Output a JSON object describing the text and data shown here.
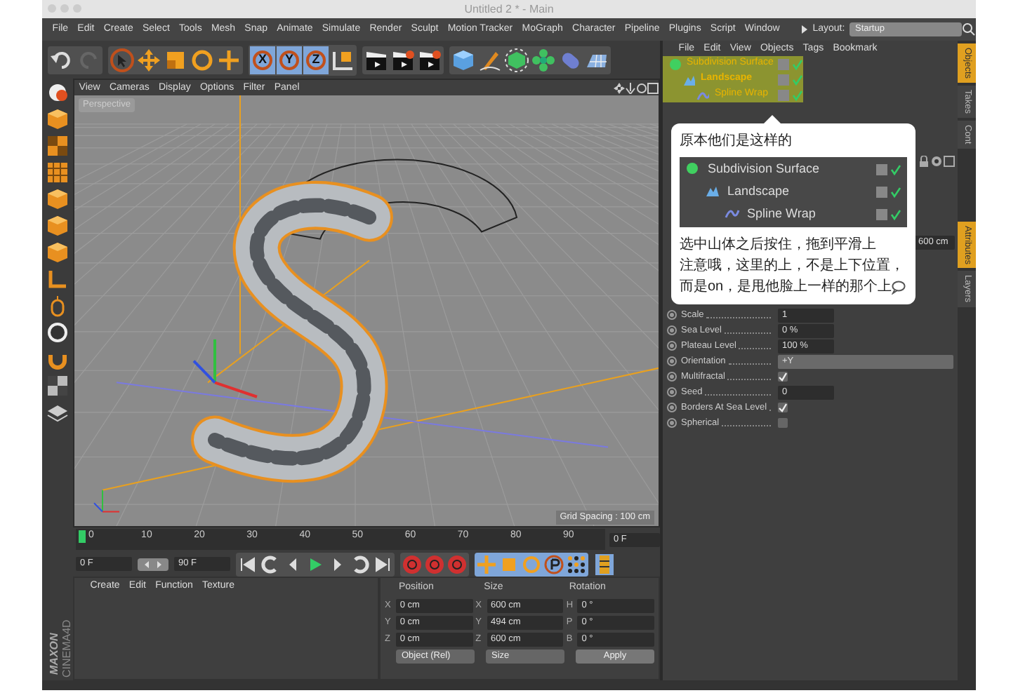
{
  "window": {
    "title": "Untitled 2 * - Main"
  },
  "menu": [
    "File",
    "Edit",
    "Create",
    "Select",
    "Tools",
    "Mesh",
    "Snap",
    "Animate",
    "Simulate",
    "Render",
    "Sculpt",
    "Motion Tracker",
    "MoGraph",
    "Character",
    "Pipeline",
    "Plugins",
    "Script",
    "Window"
  ],
  "layout": {
    "label": "Layout:",
    "value": "Startup"
  },
  "axis_buttons": [
    "X",
    "Y",
    "Z"
  ],
  "viewport": {
    "menu": [
      "View",
      "Cameras",
      "Display",
      "Options",
      "Filter",
      "Panel"
    ],
    "camera": "Perspective",
    "grid_spacing": "Grid Spacing : 100 cm"
  },
  "timeline": {
    "ticks": [
      "0",
      "10",
      "20",
      "30",
      "40",
      "50",
      "60",
      "70",
      "80",
      "90"
    ],
    "frame_field": "0 F"
  },
  "transport": {
    "start_field": "0 F",
    "end_field": "90 F"
  },
  "material_manager": {
    "menu": [
      "Create",
      "Edit",
      "Function",
      "Texture"
    ]
  },
  "coordinates": {
    "headers": [
      "Position",
      "Size",
      "Rotation"
    ],
    "rows": [
      [
        {
          "axis": "X",
          "value": "0 cm"
        },
        {
          "axis": "X",
          "value": "600 cm"
        },
        {
          "axis": "H",
          "value": "0 °"
        }
      ],
      [
        {
          "axis": "Y",
          "value": "0 cm"
        },
        {
          "axis": "Y",
          "value": "494 cm"
        },
        {
          "axis": "P",
          "value": "0 °"
        }
      ],
      [
        {
          "axis": "Z",
          "value": "0 cm"
        },
        {
          "axis": "Z",
          "value": "600 cm"
        },
        {
          "axis": "B",
          "value": "0 °"
        }
      ]
    ],
    "dropdowns": [
      "Object (Rel)",
      "Size"
    ],
    "apply": "Apply"
  },
  "brand": {
    "maker": "MAXON",
    "product": "CINEMA4D"
  },
  "object_manager": {
    "menu": [
      "File",
      "Edit",
      "View",
      "Objects",
      "Tags",
      "Bookmark"
    ],
    "objects": [
      {
        "name": "Subdivision Surface",
        "selected": true,
        "children": [
          {
            "name": "Landscape",
            "selected": true,
            "children": [
              {
                "name": "Spline Wrap",
                "selected": true
              }
            ]
          }
        ]
      }
    ]
  },
  "attributes": {
    "partial_field": "600 cm",
    "params": [
      {
        "kind": "number",
        "label": "Scale",
        "value": "1"
      },
      {
        "kind": "number",
        "label": "Sea Level",
        "value": "0 %"
      },
      {
        "kind": "number",
        "label": "Plateau Level",
        "value": "100 %"
      },
      {
        "kind": "dropdown",
        "label": "Orientation",
        "value": "+Y"
      },
      {
        "kind": "checkbox",
        "label": "Multifractal",
        "checked": true
      },
      {
        "kind": "number",
        "label": "Seed",
        "value": "0"
      },
      {
        "kind": "checkbox",
        "label": "Borders At Sea Level",
        "checked": true
      },
      {
        "kind": "checkbox",
        "label": "Spherical",
        "checked": false
      }
    ]
  },
  "side_tabs": [
    {
      "label": "Objects",
      "selected": true
    },
    {
      "label": "Takes",
      "selected": false
    },
    {
      "label": "Cont",
      "selected": false
    },
    {
      "label": "Attributes",
      "selected": true
    },
    {
      "label": "Layers",
      "selected": false
    }
  ],
  "callout": {
    "heading": "原本他们是这样的",
    "inset_objects": [
      {
        "name": "Subdivision Surface",
        "children": [
          {
            "name": "Landscape",
            "children": [
              {
                "name": "Spline Wrap"
              }
            ]
          }
        ]
      }
    ],
    "note_lines": [
      "选中山体之后按住，拖到平滑上",
      "注意哦，这里的上，不是上下位置，",
      "而是on，是甩他脸上一样的那个上"
    ]
  }
}
